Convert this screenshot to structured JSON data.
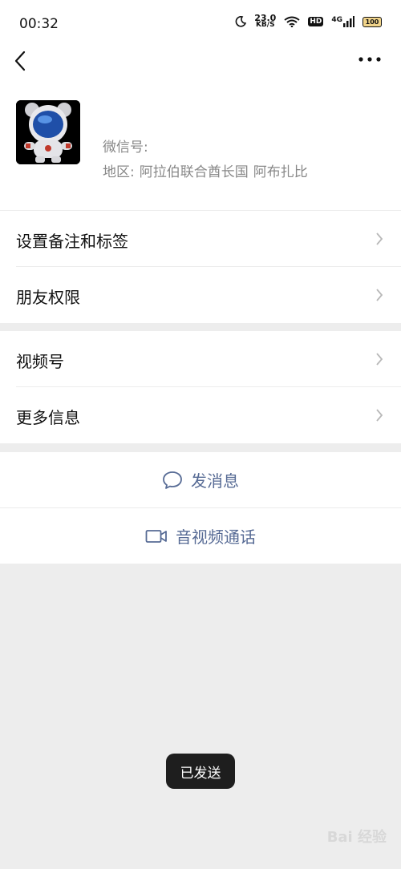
{
  "status_bar": {
    "time": "00:32",
    "net_speed_value": "23.0",
    "net_speed_unit": "KB/S",
    "hd": "HD",
    "network": "4G",
    "battery": "100"
  },
  "profile": {
    "wechat_id_label": "微信号:",
    "region_label": "地区:",
    "region_country": "阿拉伯联合酋长国",
    "region_city": "阿布扎比"
  },
  "menu": {
    "items": [
      {
        "label": "设置备注和标签"
      },
      {
        "label": "朋友权限"
      },
      {
        "label": "视频号"
      },
      {
        "label": "更多信息"
      }
    ]
  },
  "actions": {
    "send_message": "发消息",
    "av_call": "音视频通话"
  },
  "toast": {
    "text": "已发送"
  },
  "watermark": {
    "text": "Bai 经验"
  }
}
